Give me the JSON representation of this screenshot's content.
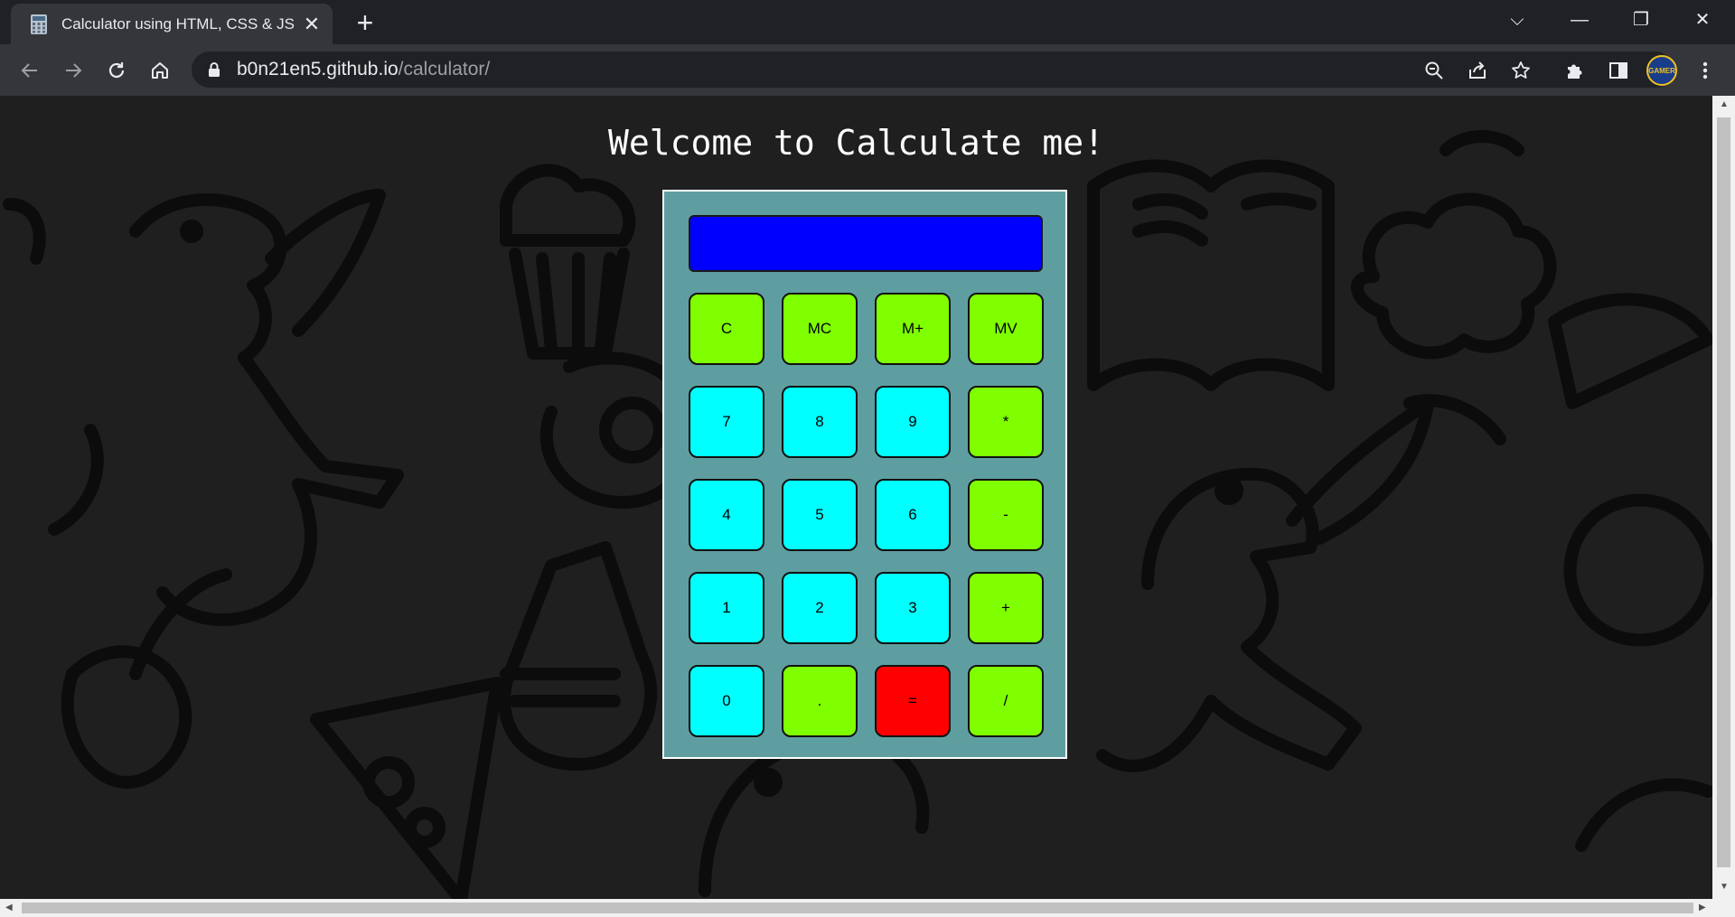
{
  "browser": {
    "tab_title": "Calculator using HTML, CSS & JS",
    "tab_close": "✕",
    "new_tab": "+",
    "url_domain": "b0n21en5.github.io",
    "url_path": "/calculator/",
    "avatar_text": "GAMER",
    "window_controls": {
      "tab_search": "⌵",
      "minimize": "—",
      "restore": "❐",
      "close": "✕"
    }
  },
  "page": {
    "title": "Welcome to Calculate me!",
    "display_value": ""
  },
  "keys": {
    "c": "C",
    "mc": "MC",
    "mplus": "M+",
    "mv": "MV",
    "k7": "7",
    "k8": "8",
    "k9": "9",
    "mul": "*",
    "k4": "4",
    "k5": "5",
    "k6": "6",
    "sub": "-",
    "k1": "1",
    "k2": "2",
    "k3": "3",
    "add": "+",
    "k0": "0",
    "dot": ".",
    "eq": "=",
    "div": "/"
  },
  "colors": {
    "display": "#0000ff",
    "number_key": "#00ffff",
    "operator_key": "#7fff00",
    "equals_key": "#ff0000",
    "calculator_body": "#5f9ea0"
  }
}
